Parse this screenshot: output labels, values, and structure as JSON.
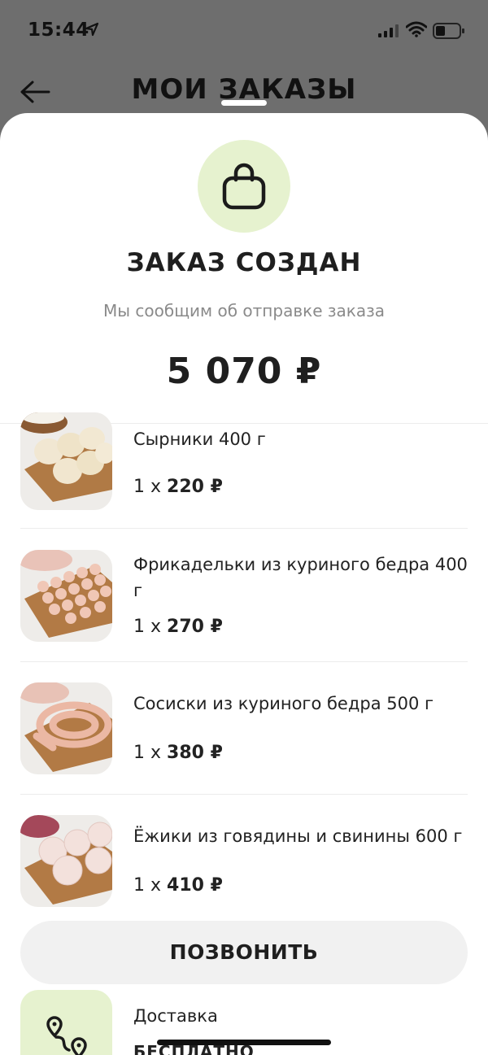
{
  "status_bar": {
    "time": "15:44"
  },
  "header": {
    "title": "МОИ ЗАКАЗЫ"
  },
  "order": {
    "title": "ЗАКАЗ СОЗДАН",
    "subtitle": "Мы сообщим об отправке заказа",
    "total": "5 070 ₽"
  },
  "items": [
    {
      "name": "Сырники 400 г",
      "qty": "1 x",
      "price": "220 ₽"
    },
    {
      "name": "Фрикадельки из куриного бедра 400 г",
      "qty": "1 x",
      "price": "270 ₽"
    },
    {
      "name": "Сосиски из куриного бедра 500 г",
      "qty": "1 x",
      "price": "380 ₽"
    },
    {
      "name": "Ёжики из говядины и свинины 600 г",
      "qty": "1 x",
      "price": "410 ₽"
    }
  ],
  "actions": {
    "call_label": "ПОЗВОНИТЬ"
  },
  "delivery": {
    "label": "Доставка",
    "value": "БЕСПЛАТНО"
  },
  "colors": {
    "accent_bg": "#e6f2cf",
    "overlay": "#6e6e6e",
    "button_bg": "#f1f1f1"
  },
  "icons": [
    "location-arrow-icon",
    "signal-icon",
    "wifi-icon",
    "battery-icon",
    "back-arrow-icon",
    "shopping-bag-icon",
    "route-icon"
  ]
}
